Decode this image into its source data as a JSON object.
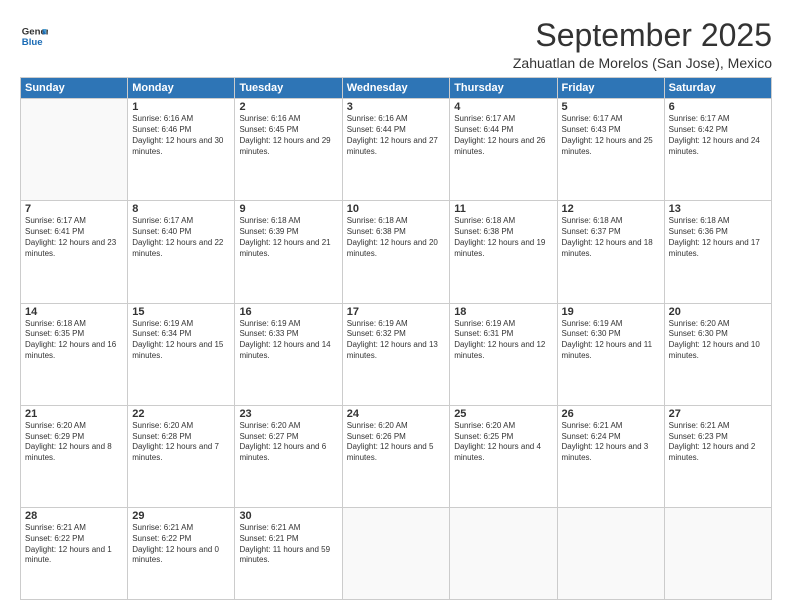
{
  "logo": {
    "line1": "General",
    "line2": "Blue"
  },
  "title": "September 2025",
  "location": "Zahuatlan de Morelos (San Jose), Mexico",
  "weekdays": [
    "Sunday",
    "Monday",
    "Tuesday",
    "Wednesday",
    "Thursday",
    "Friday",
    "Saturday"
  ],
  "weeks": [
    [
      {
        "day": "",
        "sunrise": "",
        "sunset": "",
        "daylight": ""
      },
      {
        "day": "1",
        "sunrise": "Sunrise: 6:16 AM",
        "sunset": "Sunset: 6:46 PM",
        "daylight": "Daylight: 12 hours and 30 minutes."
      },
      {
        "day": "2",
        "sunrise": "Sunrise: 6:16 AM",
        "sunset": "Sunset: 6:45 PM",
        "daylight": "Daylight: 12 hours and 29 minutes."
      },
      {
        "day": "3",
        "sunrise": "Sunrise: 6:16 AM",
        "sunset": "Sunset: 6:44 PM",
        "daylight": "Daylight: 12 hours and 27 minutes."
      },
      {
        "day": "4",
        "sunrise": "Sunrise: 6:17 AM",
        "sunset": "Sunset: 6:44 PM",
        "daylight": "Daylight: 12 hours and 26 minutes."
      },
      {
        "day": "5",
        "sunrise": "Sunrise: 6:17 AM",
        "sunset": "Sunset: 6:43 PM",
        "daylight": "Daylight: 12 hours and 25 minutes."
      },
      {
        "day": "6",
        "sunrise": "Sunrise: 6:17 AM",
        "sunset": "Sunset: 6:42 PM",
        "daylight": "Daylight: 12 hours and 24 minutes."
      }
    ],
    [
      {
        "day": "7",
        "sunrise": "Sunrise: 6:17 AM",
        "sunset": "Sunset: 6:41 PM",
        "daylight": "Daylight: 12 hours and 23 minutes."
      },
      {
        "day": "8",
        "sunrise": "Sunrise: 6:17 AM",
        "sunset": "Sunset: 6:40 PM",
        "daylight": "Daylight: 12 hours and 22 minutes."
      },
      {
        "day": "9",
        "sunrise": "Sunrise: 6:18 AM",
        "sunset": "Sunset: 6:39 PM",
        "daylight": "Daylight: 12 hours and 21 minutes."
      },
      {
        "day": "10",
        "sunrise": "Sunrise: 6:18 AM",
        "sunset": "Sunset: 6:38 PM",
        "daylight": "Daylight: 12 hours and 20 minutes."
      },
      {
        "day": "11",
        "sunrise": "Sunrise: 6:18 AM",
        "sunset": "Sunset: 6:38 PM",
        "daylight": "Daylight: 12 hours and 19 minutes."
      },
      {
        "day": "12",
        "sunrise": "Sunrise: 6:18 AM",
        "sunset": "Sunset: 6:37 PM",
        "daylight": "Daylight: 12 hours and 18 minutes."
      },
      {
        "day": "13",
        "sunrise": "Sunrise: 6:18 AM",
        "sunset": "Sunset: 6:36 PM",
        "daylight": "Daylight: 12 hours and 17 minutes."
      }
    ],
    [
      {
        "day": "14",
        "sunrise": "Sunrise: 6:18 AM",
        "sunset": "Sunset: 6:35 PM",
        "daylight": "Daylight: 12 hours and 16 minutes."
      },
      {
        "day": "15",
        "sunrise": "Sunrise: 6:19 AM",
        "sunset": "Sunset: 6:34 PM",
        "daylight": "Daylight: 12 hours and 15 minutes."
      },
      {
        "day": "16",
        "sunrise": "Sunrise: 6:19 AM",
        "sunset": "Sunset: 6:33 PM",
        "daylight": "Daylight: 12 hours and 14 minutes."
      },
      {
        "day": "17",
        "sunrise": "Sunrise: 6:19 AM",
        "sunset": "Sunset: 6:32 PM",
        "daylight": "Daylight: 12 hours and 13 minutes."
      },
      {
        "day": "18",
        "sunrise": "Sunrise: 6:19 AM",
        "sunset": "Sunset: 6:31 PM",
        "daylight": "Daylight: 12 hours and 12 minutes."
      },
      {
        "day": "19",
        "sunrise": "Sunrise: 6:19 AM",
        "sunset": "Sunset: 6:30 PM",
        "daylight": "Daylight: 12 hours and 11 minutes."
      },
      {
        "day": "20",
        "sunrise": "Sunrise: 6:20 AM",
        "sunset": "Sunset: 6:30 PM",
        "daylight": "Daylight: 12 hours and 10 minutes."
      }
    ],
    [
      {
        "day": "21",
        "sunrise": "Sunrise: 6:20 AM",
        "sunset": "Sunset: 6:29 PM",
        "daylight": "Daylight: 12 hours and 8 minutes."
      },
      {
        "day": "22",
        "sunrise": "Sunrise: 6:20 AM",
        "sunset": "Sunset: 6:28 PM",
        "daylight": "Daylight: 12 hours and 7 minutes."
      },
      {
        "day": "23",
        "sunrise": "Sunrise: 6:20 AM",
        "sunset": "Sunset: 6:27 PM",
        "daylight": "Daylight: 12 hours and 6 minutes."
      },
      {
        "day": "24",
        "sunrise": "Sunrise: 6:20 AM",
        "sunset": "Sunset: 6:26 PM",
        "daylight": "Daylight: 12 hours and 5 minutes."
      },
      {
        "day": "25",
        "sunrise": "Sunrise: 6:20 AM",
        "sunset": "Sunset: 6:25 PM",
        "daylight": "Daylight: 12 hours and 4 minutes."
      },
      {
        "day": "26",
        "sunrise": "Sunrise: 6:21 AM",
        "sunset": "Sunset: 6:24 PM",
        "daylight": "Daylight: 12 hours and 3 minutes."
      },
      {
        "day": "27",
        "sunrise": "Sunrise: 6:21 AM",
        "sunset": "Sunset: 6:23 PM",
        "daylight": "Daylight: 12 hours and 2 minutes."
      }
    ],
    [
      {
        "day": "28",
        "sunrise": "Sunrise: 6:21 AM",
        "sunset": "Sunset: 6:22 PM",
        "daylight": "Daylight: 12 hours and 1 minute."
      },
      {
        "day": "29",
        "sunrise": "Sunrise: 6:21 AM",
        "sunset": "Sunset: 6:22 PM",
        "daylight": "Daylight: 12 hours and 0 minutes."
      },
      {
        "day": "30",
        "sunrise": "Sunrise: 6:21 AM",
        "sunset": "Sunset: 6:21 PM",
        "daylight": "Daylight: 11 hours and 59 minutes."
      },
      {
        "day": "",
        "sunrise": "",
        "sunset": "",
        "daylight": ""
      },
      {
        "day": "",
        "sunrise": "",
        "sunset": "",
        "daylight": ""
      },
      {
        "day": "",
        "sunrise": "",
        "sunset": "",
        "daylight": ""
      },
      {
        "day": "",
        "sunrise": "",
        "sunset": "",
        "daylight": ""
      }
    ]
  ]
}
